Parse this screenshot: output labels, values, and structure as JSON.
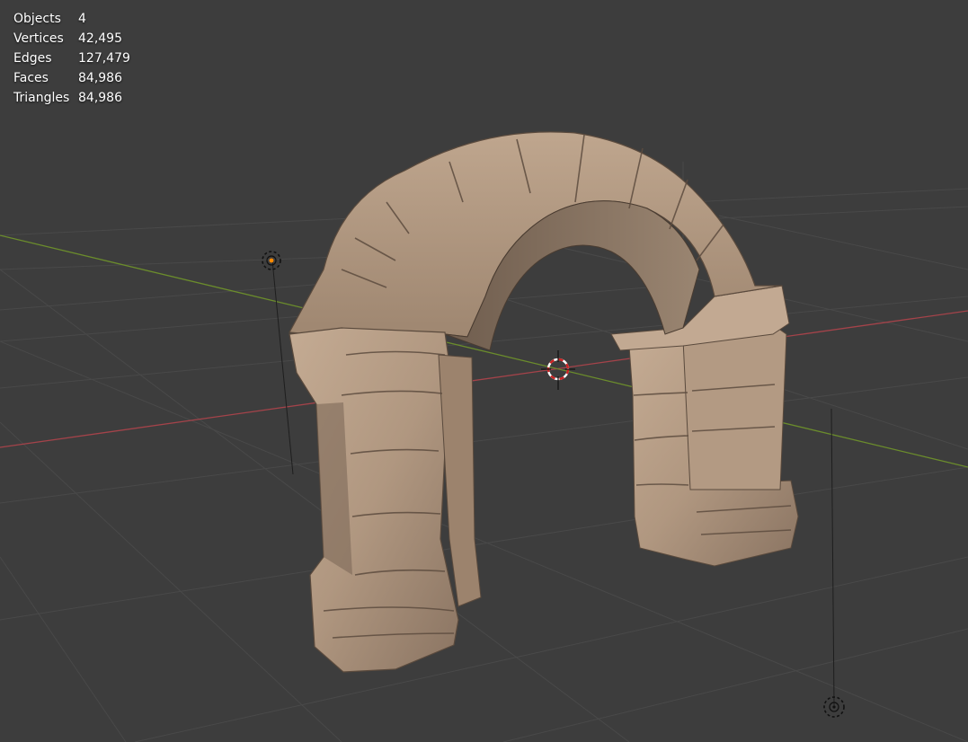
{
  "viewport": {
    "background": "#3d3d3d",
    "grid_color": "#494949",
    "x_axis_color": "#a4434a",
    "y_axis_color": "#6b8c2c",
    "stone_color": "#b49b85",
    "cursor_color": "#cc2222"
  },
  "statistics": [
    {
      "label": "Objects",
      "value": "4"
    },
    {
      "label": "Vertices",
      "value": "42,495"
    },
    {
      "label": "Edges",
      "value": "127,479"
    },
    {
      "label": "Faces",
      "value": "84,986"
    },
    {
      "label": "Triangles",
      "value": "84,986"
    }
  ],
  "scene_objects": [
    {
      "type": "mesh",
      "name_icon": "stone-archway"
    },
    {
      "type": "light",
      "name_icon": "point-light-icon"
    },
    {
      "type": "light",
      "name_icon": "point-light-icon"
    },
    {
      "type": "cursor",
      "name_icon": "3d-cursor-icon"
    }
  ]
}
